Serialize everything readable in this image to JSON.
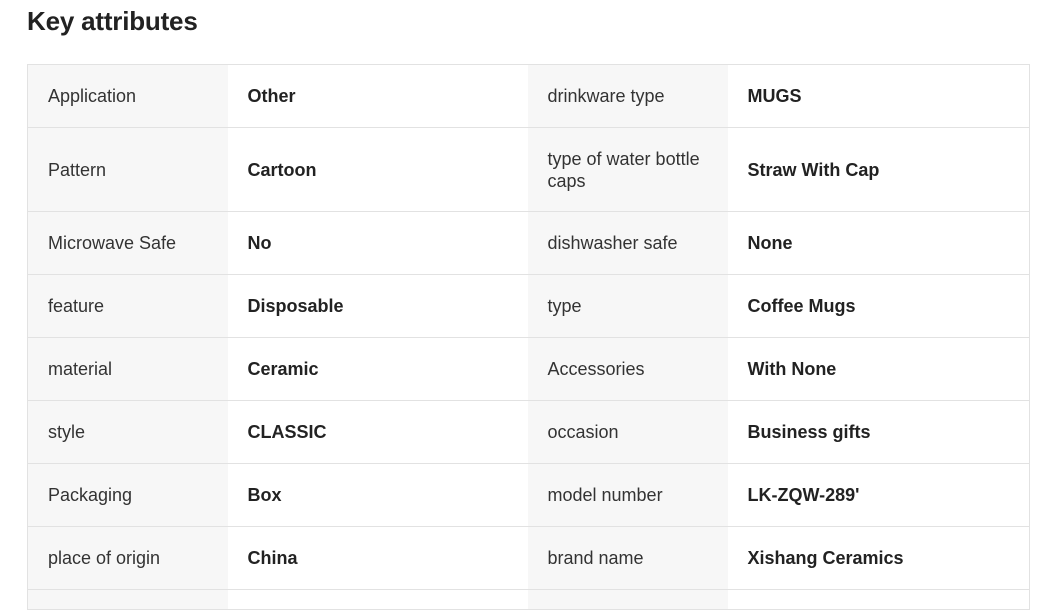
{
  "section": {
    "title": "Key attributes"
  },
  "rows": [
    {
      "label_left": "Application",
      "value_left": "Other",
      "label_right": "drinkware type",
      "value_right": "MUGS"
    },
    {
      "label_left": "Pattern",
      "value_left": "Cartoon",
      "label_right": "type of water bottle caps",
      "value_right": "Straw With Cap"
    },
    {
      "label_left": "Microwave Safe",
      "value_left": "No",
      "label_right": "dishwasher safe",
      "value_right": "None"
    },
    {
      "label_left": "feature",
      "value_left": "Disposable",
      "label_right": "type",
      "value_right": "Coffee Mugs"
    },
    {
      "label_left": "material",
      "value_left": "Ceramic",
      "label_right": "Accessories",
      "value_right": "With None"
    },
    {
      "label_left": "style",
      "value_left": "CLASSIC",
      "label_right": "occasion",
      "value_right": "Business gifts"
    },
    {
      "label_left": "Packaging",
      "value_left": "Box",
      "label_right": "model number",
      "value_right": "LK-ZQW-289'"
    },
    {
      "label_left": "place of origin",
      "value_left": "China",
      "label_right": "brand name",
      "value_right": "Xishang Ceramics"
    }
  ],
  "colors": {
    "label_bg": "#f7f7f7",
    "value_bg": "#ffffff",
    "border": "#e2e2e2",
    "text": "#222222"
  }
}
